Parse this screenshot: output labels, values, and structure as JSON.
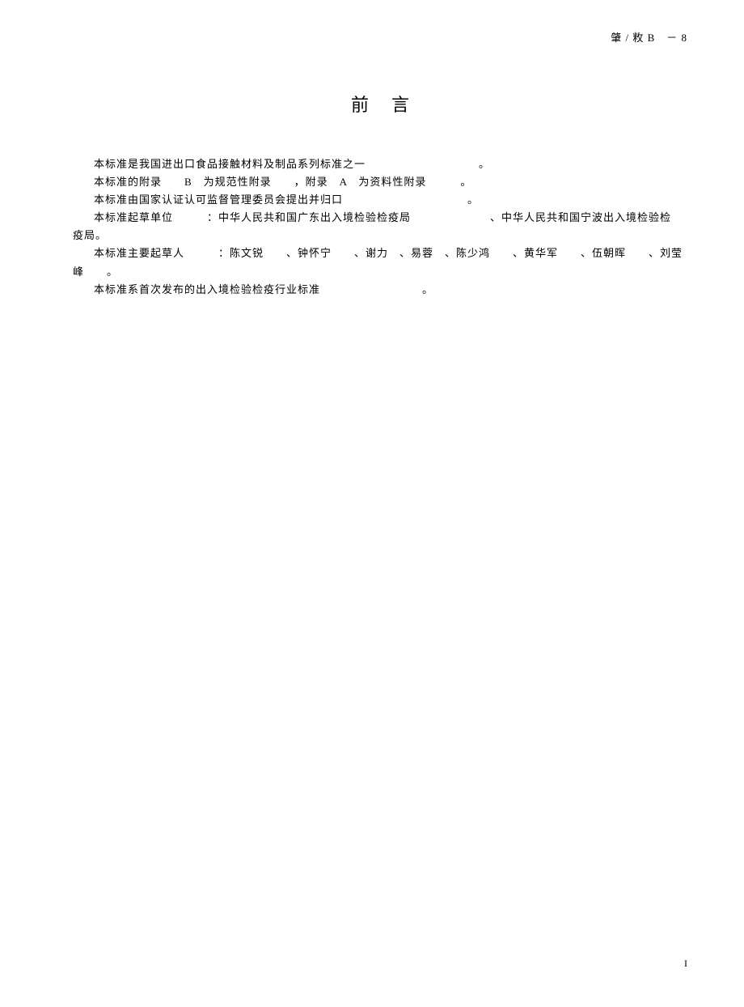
{
  "header": {
    "code": "肇 / 敉 B　－ 8"
  },
  "title": "前言",
  "paragraphs": {
    "p1": "本标准是我国进出口食品接触材料及制品系列标准之一　　　　　　　　　　。",
    "p2": "本标准的附录　　B　为规范性附录　　，附录　A　为资料性附录　　　。",
    "p3": "本标准由国家认证认可监督管理委员会提出并归口　　　　　　　　　　　。",
    "p4": "本标准起草单位　　　：中华人民共和国广东出入境检验检疫局　　　　　　　、中华人民共和国宁波出入境检验检",
    "p4b": "疫局。",
    "p5": "本标准主要起草人　　　：陈文锐　　、钟怀宁　　、谢力　、易蓉　、陈少鸿　　、黄华军　　、伍朝晖　　、刘莹峰　　。",
    "p6": "本标准系首次发布的出入境检验检疫行业标准　　　　　　　　　。"
  },
  "pageNumber": "I"
}
